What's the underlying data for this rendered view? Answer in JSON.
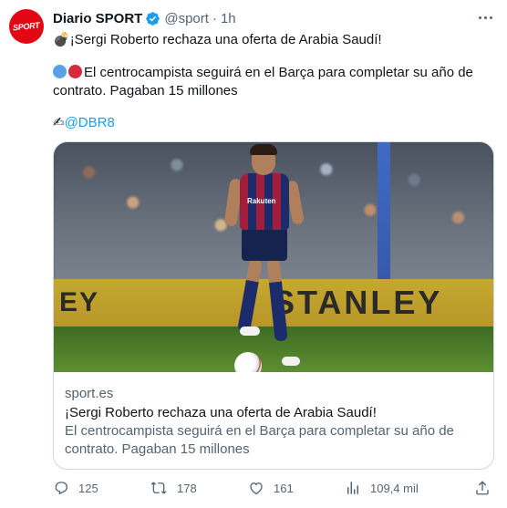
{
  "author": {
    "name": "Diario SPORT",
    "avatar_text": "SPORT",
    "handle": "@sport",
    "separator": "·",
    "time": "1h"
  },
  "tweet": {
    "line1_emoji": "💣",
    "line1_text": "¡Sergi Roberto rechaza una oferta de Arabia Saudí!",
    "line2_text": "El centrocampista seguirá en el Barça para completar su año de",
    "line3_text": "contrato. Pagaban 15 millones",
    "line4_emoji": "✍",
    "mention": "@DBR8"
  },
  "card": {
    "ad_left": "EY",
    "ad_right": "STANLEY",
    "shirt_logo": "Rakuten",
    "domain": "sport.es",
    "title": "¡Sergi Roberto rechaza una oferta de Arabia Saudí!",
    "desc_line1": "El centrocampista seguirá en el Barça para completar su año de",
    "desc_line2": "contrato. Pagaban 15 millones"
  },
  "actions": {
    "replies": "125",
    "reposts": "178",
    "likes": "161",
    "views": "109,4 mil"
  },
  "colors": {
    "accent": "#1d9bf0",
    "brand_red": "#e30613",
    "muted": "#536471",
    "border": "#cfd9de"
  },
  "icons": [
    "verified-badge-icon",
    "more-icon",
    "reply-icon",
    "repost-icon",
    "like-icon",
    "views-icon",
    "share-icon"
  ]
}
